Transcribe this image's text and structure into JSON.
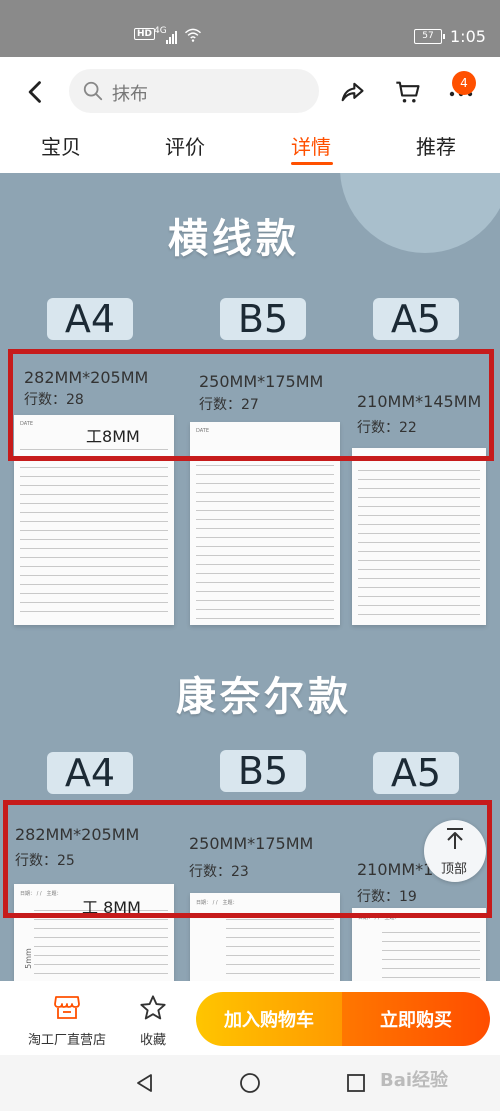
{
  "status_bar": {
    "hd": "HD",
    "network": "4G",
    "battery": "57",
    "time": "1:05"
  },
  "header": {
    "search_text": "抹布",
    "cart_badge": "4"
  },
  "tabs": [
    {
      "label": "宝贝"
    },
    {
      "label": "评价"
    },
    {
      "label": "详情"
    },
    {
      "label": "推荐"
    }
  ],
  "section1": {
    "title": "横线款",
    "items": [
      {
        "size": "A4",
        "dim": "282MM*205MM",
        "rows": "行数：28"
      },
      {
        "size": "B5",
        "dim": "250MM*175MM",
        "rows": "行数：27"
      },
      {
        "size": "A5",
        "dim": "210MM*145MM",
        "rows": "行数：22"
      }
    ],
    "spacing": "8MM"
  },
  "section2": {
    "title": "康奈尔款",
    "items": [
      {
        "size": "A4",
        "dim": "282MM*205MM",
        "rows": "行数：25"
      },
      {
        "size": "B5",
        "dim": "250MM*175MM",
        "rows": "行数：23"
      },
      {
        "size": "A5",
        "dim": "210MM*1",
        "rows": "行数：19"
      }
    ],
    "spacing": "8MM"
  },
  "top_button": {
    "label": "顶部"
  },
  "bottom_bar": {
    "store_label": "淘工厂直营店",
    "fav_label": "收藏",
    "cart_button": "加入购物车",
    "buy_button": "立即购买"
  },
  "watermark": "Bai经验",
  "colors": {
    "accent": "#ff5000",
    "highlight_box": "#c61b1b",
    "content_bg": "#8ea4b3"
  }
}
